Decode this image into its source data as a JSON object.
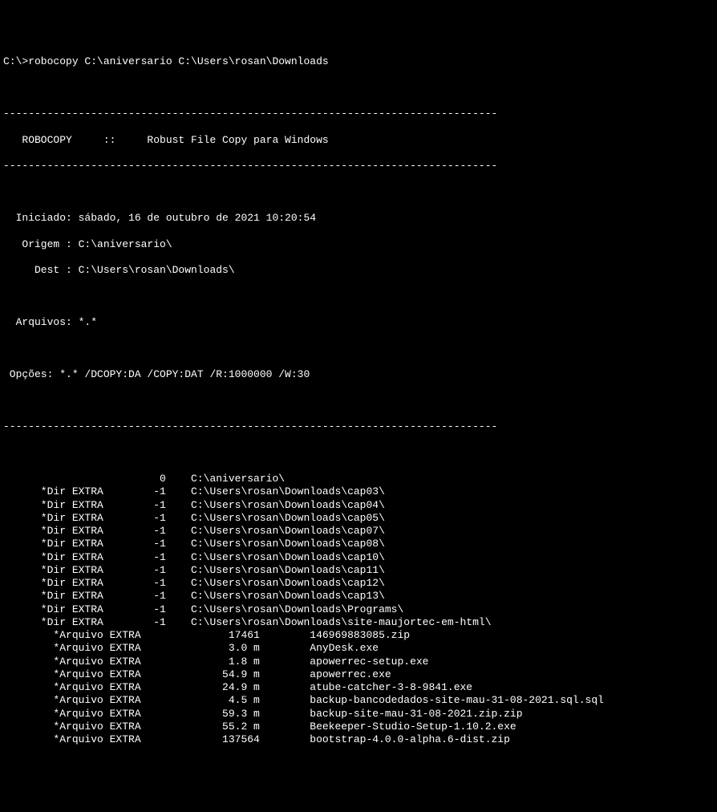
{
  "prompt": "C:\\>robocopy C:\\aniversario C:\\Users\\rosan\\Downloads",
  "dash_line": "-------------------------------------------------------------------------------",
  "header_title": "   ROBOCOPY     ::     Robust File Copy para Windows",
  "info": {
    "iniciado": "  Iniciado: sábado, 16 de outubro de 2021 10:20:54",
    "origem": "   Origem : C:\\aniversario\\",
    "dest": "     Dest : C:\\Users\\rosan\\Downloads\\",
    "arquivos": "  Arquivos: *.*",
    "opcoes": " Opções: *.* /DCOPY:DA /COPY:DAT /R:1000000 /W:30"
  },
  "rows": [
    {
      "col1": "                ",
      "col2": "         0",
      "col3": "    C:\\aniversario\\"
    },
    {
      "col1": "      *Dir EXTRA",
      "col2": "        -1",
      "col3": "    C:\\Users\\rosan\\Downloads\\cap03\\"
    },
    {
      "col1": "      *Dir EXTRA",
      "col2": "        -1",
      "col3": "    C:\\Users\\rosan\\Downloads\\cap04\\"
    },
    {
      "col1": "      *Dir EXTRA",
      "col2": "        -1",
      "col3": "    C:\\Users\\rosan\\Downloads\\cap05\\"
    },
    {
      "col1": "      *Dir EXTRA",
      "col2": "        -1",
      "col3": "    C:\\Users\\rosan\\Downloads\\cap07\\"
    },
    {
      "col1": "      *Dir EXTRA",
      "col2": "        -1",
      "col3": "    C:\\Users\\rosan\\Downloads\\cap08\\"
    },
    {
      "col1": "      *Dir EXTRA",
      "col2": "        -1",
      "col3": "    C:\\Users\\rosan\\Downloads\\cap10\\"
    },
    {
      "col1": "      *Dir EXTRA",
      "col2": "        -1",
      "col3": "    C:\\Users\\rosan\\Downloads\\cap11\\"
    },
    {
      "col1": "      *Dir EXTRA",
      "col2": "        -1",
      "col3": "    C:\\Users\\rosan\\Downloads\\cap12\\"
    },
    {
      "col1": "      *Dir EXTRA",
      "col2": "        -1",
      "col3": "    C:\\Users\\rosan\\Downloads\\cap13\\"
    },
    {
      "col1": "      *Dir EXTRA",
      "col2": "        -1",
      "col3": "    C:\\Users\\rosan\\Downloads\\Programs\\"
    },
    {
      "col1": "      *Dir EXTRA",
      "col2": "        -1",
      "col3": "    C:\\Users\\rosan\\Downloads\\site-maujortec-em-html\\"
    },
    {
      "col1": "        *Arquivo EXTRA ",
      "col2": "             17461",
      "col3": "        146969883085.zip"
    },
    {
      "col1": "        *Arquivo EXTRA ",
      "col2": "             3.0 m",
      "col3": "        AnyDesk.exe"
    },
    {
      "col1": "        *Arquivo EXTRA ",
      "col2": "             1.8 m",
      "col3": "        apowerrec-setup.exe"
    },
    {
      "col1": "        *Arquivo EXTRA ",
      "col2": "            54.9 m",
      "col3": "        apowerrec.exe"
    },
    {
      "col1": "        *Arquivo EXTRA ",
      "col2": "            24.9 m",
      "col3": "        atube-catcher-3-8-9841.exe"
    },
    {
      "col1": "        *Arquivo EXTRA ",
      "col2": "             4.5 m",
      "col3": "        backup-bancodedados-site-mau-31-08-2021.sql.sql"
    },
    {
      "col1": "        *Arquivo EXTRA ",
      "col2": "            59.3 m",
      "col3": "        backup-site-mau-31-08-2021.zip.zip"
    },
    {
      "col1": "        *Arquivo EXTRA ",
      "col2": "            55.2 m",
      "col3": "        Beekeeper-Studio-Setup-1.10.2.exe"
    },
    {
      "col1": "        *Arquivo EXTRA ",
      "col2": "            137564",
      "col3": "        bootstrap-4.0.0-alpha.6-dist.zip"
    }
  ]
}
